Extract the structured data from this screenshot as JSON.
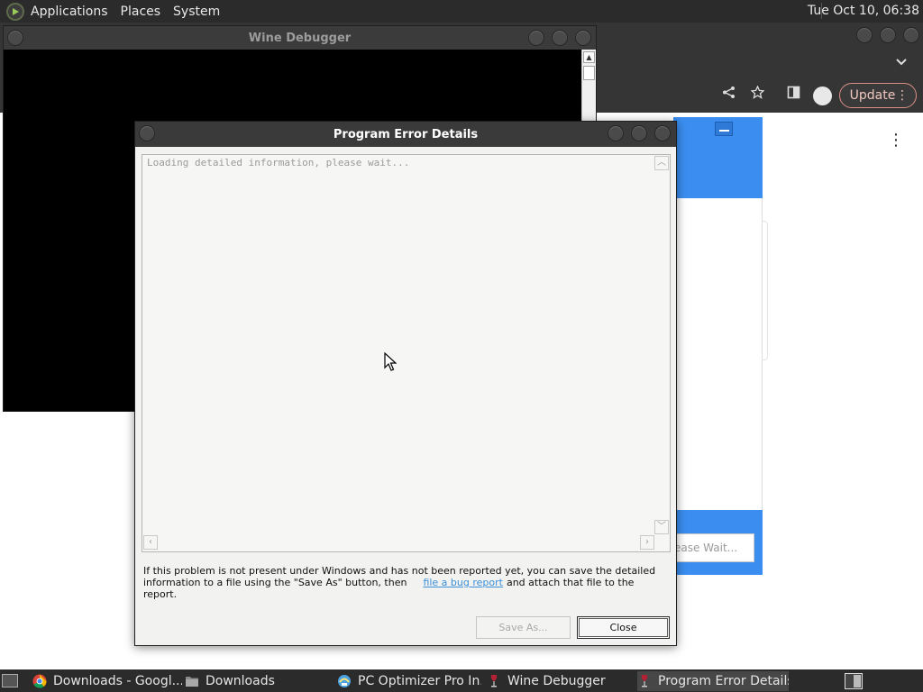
{
  "top_panel": {
    "menus": [
      "Applications",
      "Places",
      "System"
    ],
    "clock": "Tue Oct 10, 06:38"
  },
  "browser": {
    "update_label": "Update"
  },
  "installer": {
    "wait_text": "ease Wait..."
  },
  "wine_debugger": {
    "title": "Wine Debugger"
  },
  "error_dialog": {
    "title": "Program Error Details",
    "loading_text": "Loading detailed information, please wait...",
    "info_line1": "If this problem is not present under Windows and has not been reported yet, you can save the detailed",
    "info_line2_before": "information to a file using the \"Save As\" button, then",
    "info_link": "file a bug report",
    "info_line2_after": "and attach that file to the report.",
    "save_as_label": "Save As...",
    "close_label": "Close"
  },
  "taskbar": {
    "tasks": [
      {
        "label": "Downloads - Googl...",
        "icon": "chrome-icon"
      },
      {
        "label": "Downloads",
        "icon": "folder-icon"
      },
      {
        "label": "PC Optimizer Pro In...",
        "icon": "installer-icon"
      },
      {
        "label": "Wine Debugger",
        "icon": "wine-icon"
      },
      {
        "label": "Program Error Details",
        "icon": "wine-icon"
      }
    ]
  },
  "colors": {
    "panel_bg": "#2b2b2b",
    "titlebar_bg": "#3a3a3a",
    "installer_blue": "#3b8ef0",
    "link_blue": "#3b8fd8",
    "update_accent": "#d98f85"
  }
}
